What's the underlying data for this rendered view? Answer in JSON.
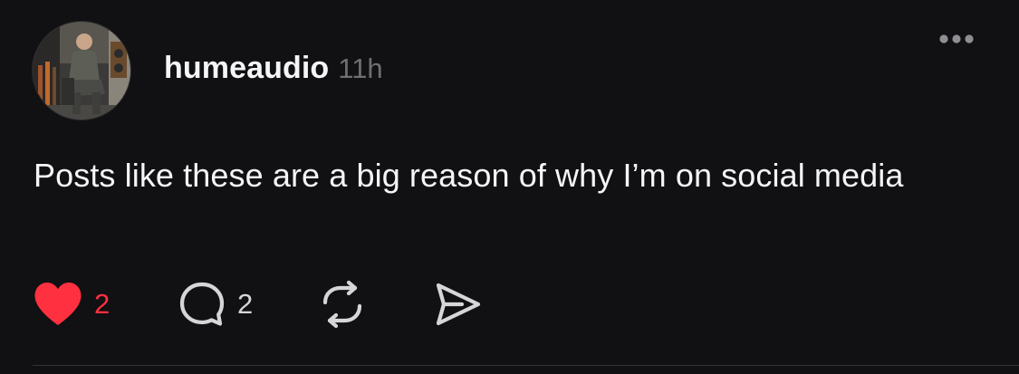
{
  "post": {
    "author": {
      "username": "humeaudio",
      "avatar_icon": "profile-photo"
    },
    "timestamp": "11h",
    "text": "Posts like these are a big reason of why I’m on social media",
    "more_icon": "ellipsis-icon",
    "actions": {
      "like": {
        "icon": "heart-icon",
        "count": "2",
        "liked": true,
        "color": "#ff3040"
      },
      "reply": {
        "icon": "comment-icon",
        "count": "2"
      },
      "repost": {
        "icon": "repost-icon"
      },
      "share": {
        "icon": "send-icon"
      }
    }
  },
  "colors": {
    "background": "#111013",
    "text_primary": "#f3f5f7",
    "text_secondary": "#6f6f73",
    "like_red": "#ff3040",
    "divider": "#323236"
  }
}
